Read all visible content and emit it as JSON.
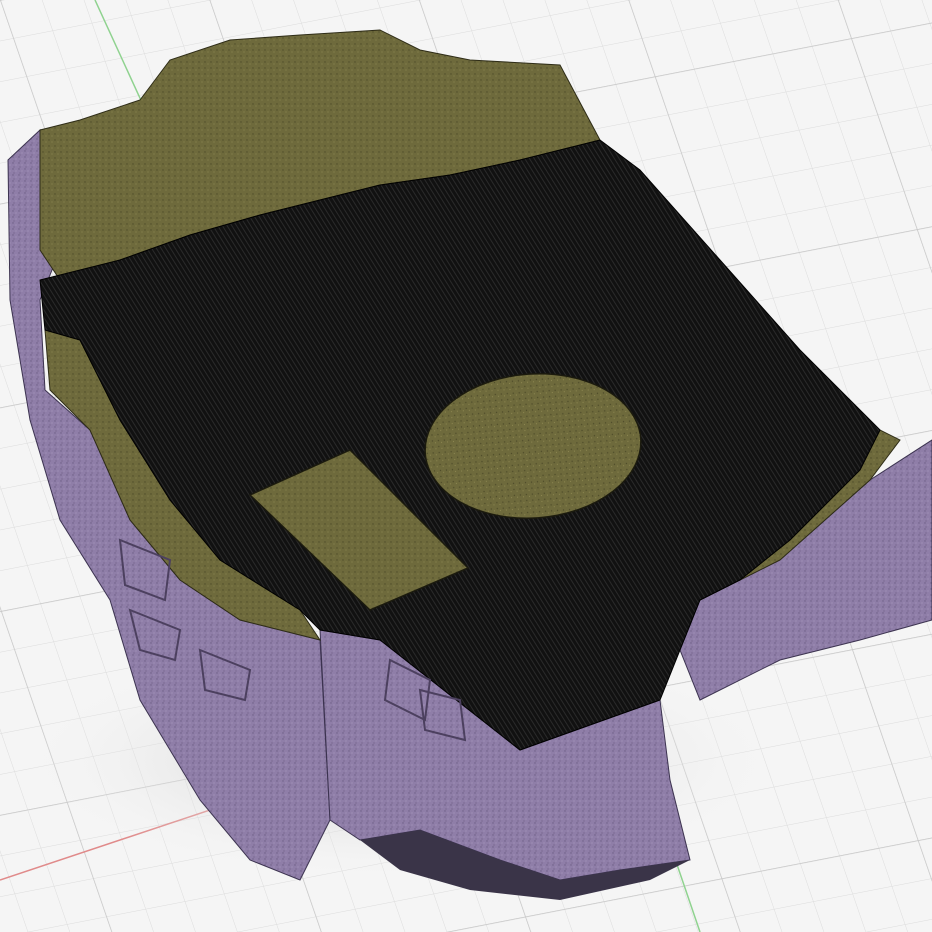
{
  "viewport": {
    "background": "#f5f5f5",
    "grid_minor": "#dcdcdc",
    "grid_major": "#c4c4c4",
    "axis_x_color": "#e08a8a",
    "axis_y_color": "#8fd28f"
  },
  "model": {
    "wall_color": "#8f7ea8",
    "inner_surface_color": "#6e6a3c",
    "cut_face_color": "#111111",
    "holes": [
      "circle",
      "rectangle"
    ]
  }
}
